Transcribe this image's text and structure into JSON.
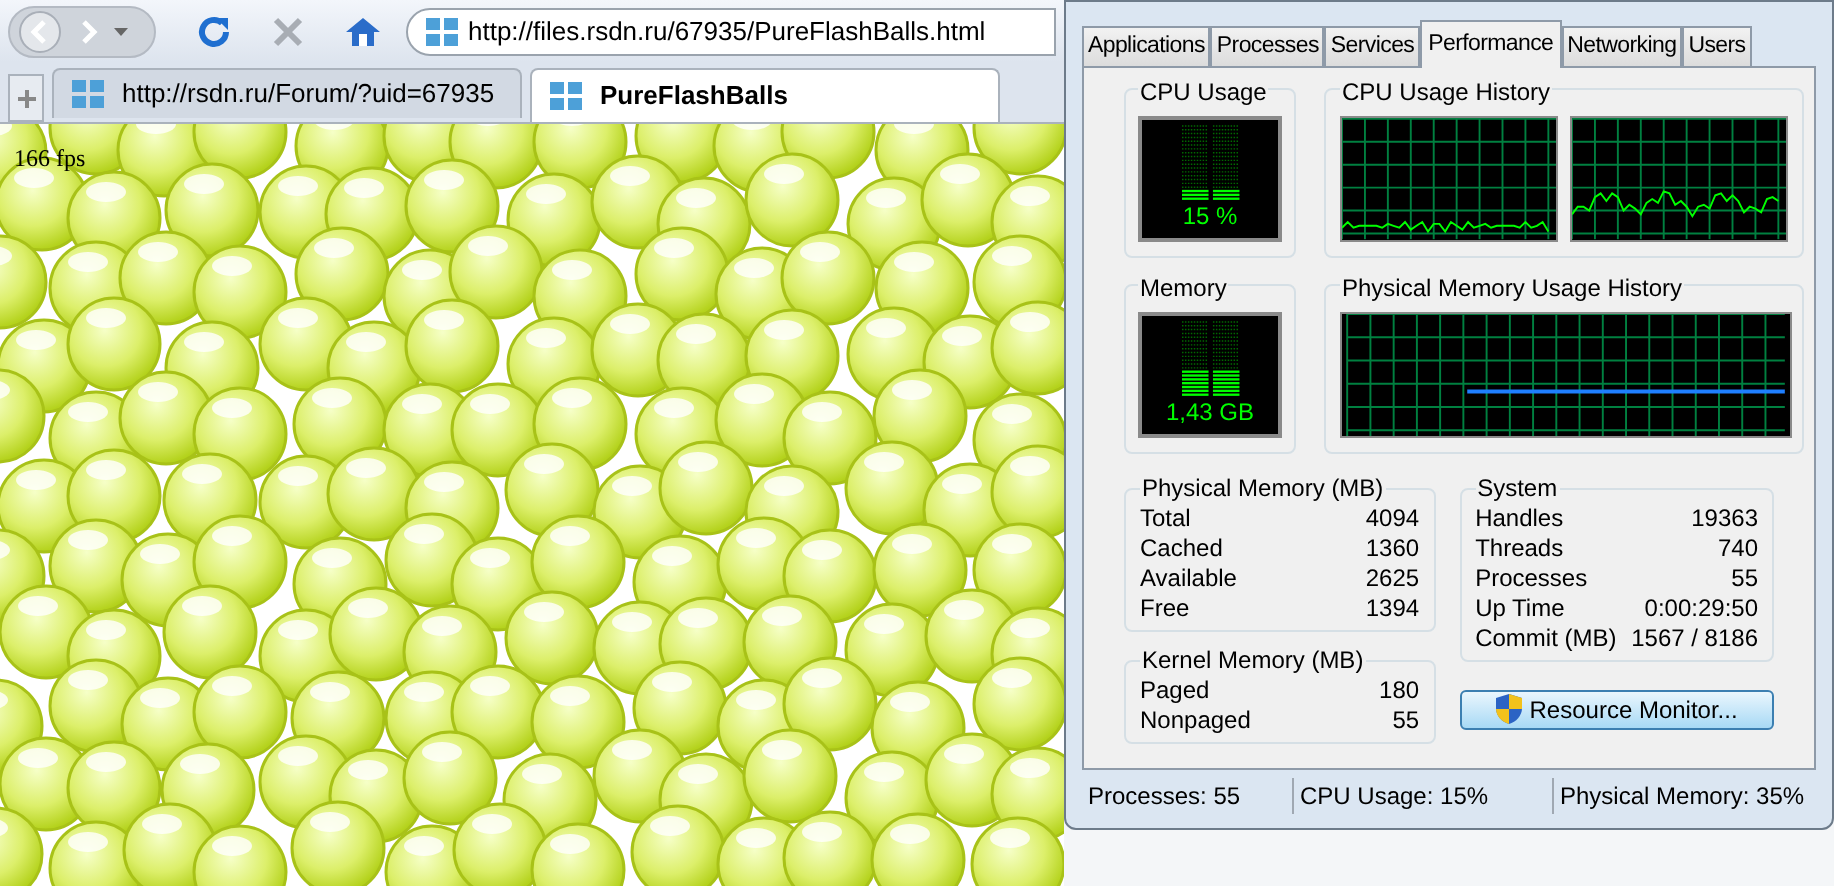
{
  "browser": {
    "address": "http://files.rsdn.ru/67935/PureFlashBalls.html",
    "tabs": [
      {
        "label": "http://rsdn.ru/Forum/?uid=67935",
        "selected": false
      },
      {
        "label": "PureFlashBalls",
        "selected": true
      }
    ],
    "fps": "166 fps"
  },
  "task_manager": {
    "tabs": [
      {
        "label": "Applications",
        "selected": false
      },
      {
        "label": "Processes",
        "selected": false
      },
      {
        "label": "Services",
        "selected": false
      },
      {
        "label": "Performance",
        "selected": true
      },
      {
        "label": "Networking",
        "selected": false
      },
      {
        "label": "Users",
        "selected": false
      }
    ],
    "cpu": {
      "title": "CPU Usage",
      "level": 0.15,
      "reading": "15 %"
    },
    "cpu_history": {
      "title": "CPU Usage History"
    },
    "memory": {
      "title": "Memory",
      "level": 0.35,
      "reading": "1,43 GB"
    },
    "memory_history": {
      "title": "Physical Memory Usage History"
    },
    "physical_memory": {
      "title": "Physical Memory (MB)",
      "rows": [
        {
          "label": "Total",
          "value": "4094"
        },
        {
          "label": "Cached",
          "value": "1360"
        },
        {
          "label": "Available",
          "value": "2625"
        },
        {
          "label": "Free",
          "value": "1394"
        }
      ]
    },
    "kernel_memory": {
      "title": "Kernel Memory (MB)",
      "rows": [
        {
          "label": "Paged",
          "value": "180"
        },
        {
          "label": "Nonpaged",
          "value": "55"
        }
      ]
    },
    "system": {
      "title": "System",
      "rows": [
        {
          "label": "Handles",
          "value": "19363"
        },
        {
          "label": "Threads",
          "value": "740"
        },
        {
          "label": "Processes",
          "value": "55"
        },
        {
          "label": "Up Time",
          "value": "0:00:29:50"
        },
        {
          "label": "Commit (MB)",
          "value": "1567 / 8186"
        }
      ]
    },
    "button": "Resource Monitor...",
    "status_bar": [
      "Processes: 55",
      "CPU Usage: 15%",
      "Physical Memory: 35%"
    ]
  }
}
